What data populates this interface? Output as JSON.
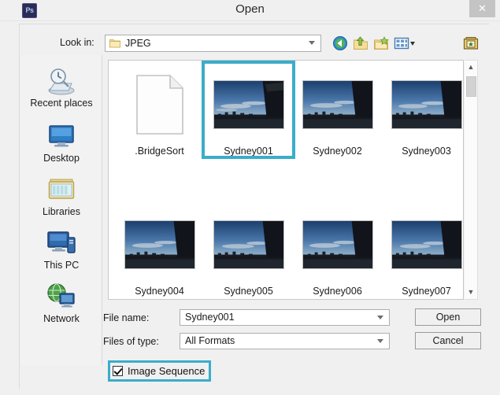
{
  "window": {
    "title": "Open",
    "app_icon": "photoshop-icon",
    "app_icon_text": "Ps",
    "close_label": "✕"
  },
  "toolbar": {
    "lookin_label": "Look in:",
    "lookin_value": "JPEG",
    "lookin_icon": "folder-icon",
    "buttons": [
      {
        "name": "back-button",
        "icon": "back-arrow-icon"
      },
      {
        "name": "up-one-level-button",
        "icon": "up-folder-icon"
      },
      {
        "name": "new-folder-button",
        "icon": "new-folder-icon"
      },
      {
        "name": "views-button",
        "icon": "views-icon"
      },
      {
        "name": "bridge-button",
        "icon": "bridge-folder-icon"
      }
    ]
  },
  "sidebar": {
    "items": [
      {
        "label": "Recent places",
        "icon": "recent-places-icon"
      },
      {
        "label": "Desktop",
        "icon": "desktop-icon"
      },
      {
        "label": "Libraries",
        "icon": "libraries-icon"
      },
      {
        "label": "This PC",
        "icon": "this-pc-icon"
      },
      {
        "label": "Network",
        "icon": "network-icon"
      }
    ]
  },
  "filelist": {
    "files": [
      {
        "name": ".BridgeSort",
        "type": "document",
        "selected": false
      },
      {
        "name": "Sydney001",
        "type": "photo",
        "selected": true
      },
      {
        "name": "Sydney002",
        "type": "photo",
        "selected": false
      },
      {
        "name": "Sydney003",
        "type": "photo",
        "selected": false
      },
      {
        "name": "Sydney004",
        "type": "photo",
        "selected": false
      },
      {
        "name": "Sydney005",
        "type": "photo",
        "selected": false
      },
      {
        "name": "Sydney006",
        "type": "photo",
        "selected": false
      },
      {
        "name": "Sydney007",
        "type": "photo",
        "selected": false
      }
    ],
    "scrollbar": {
      "up_glyph": "▲",
      "down_glyph": "▼"
    }
  },
  "form": {
    "filename_label": "File name:",
    "filename_value": "Sydney001",
    "filetype_label": "Files of type:",
    "filetype_value": "All Formats",
    "open_label": "Open",
    "cancel_label": "Cancel"
  },
  "options": {
    "image_sequence_label": "Image Sequence",
    "image_sequence_checked": true
  },
  "colors": {
    "highlight": "#3aadcb",
    "dialog_bg": "#f0f0f0",
    "list_bg": "#ffffff",
    "text": "#1a1a1a"
  }
}
